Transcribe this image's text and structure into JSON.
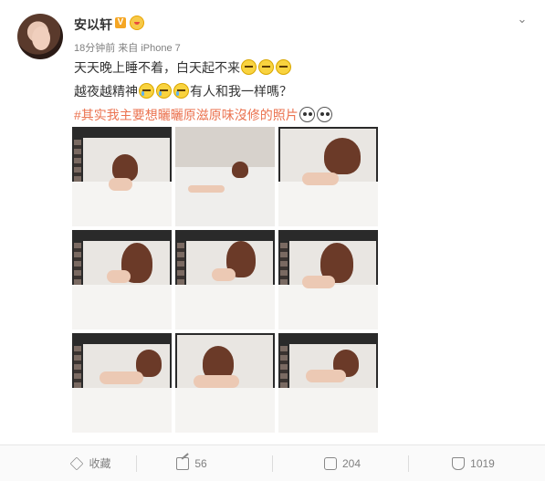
{
  "post": {
    "user": {
      "name": "安以轩",
      "verified_badge": "V"
    },
    "meta": "18分钟前 来自 iPhone 7",
    "lines": [
      {
        "text": "天天晚上睡不着，白天起不来"
      },
      {
        "text_before": "越夜越精神",
        "text_after": "有人和我一样嗎？"
      },
      {
        "hashtag": "#其实我主要想曬曬原滋原味沒修的照片"
      }
    ],
    "emojis": {
      "line1": "grimace-emoji",
      "line2": "crying-laugh-emoji",
      "line3": "panda-emoji"
    }
  },
  "footer": {
    "favorite": "收藏",
    "share_count": "56",
    "comment_count": "204",
    "like_count": "1019"
  },
  "colors": {
    "accent": "#eb7350",
    "text": "#333333",
    "muted": "#808080",
    "badge": "#f5a623"
  }
}
